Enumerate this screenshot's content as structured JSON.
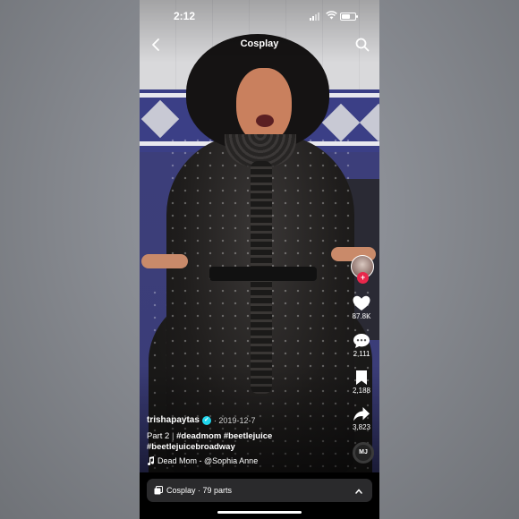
{
  "status_bar": {
    "time": "2:12"
  },
  "header": {
    "title": "Cosplay",
    "back_icon": "chevron-left-icon",
    "search_icon": "search-icon"
  },
  "actions": {
    "likes": "87.8K",
    "comments": "2,111",
    "saves": "2,188",
    "shares": "3,823",
    "follow_symbol": "+"
  },
  "caption": {
    "author": "trishapaytas",
    "date": "· 2019-12-7",
    "verified_mark": "✓",
    "part": "Part 2",
    "separator": "|",
    "hashtags_line1": "#deadmom #beetlejuice",
    "hashtags_line2": "#beetlejuicebroadway",
    "music": "Dead Mom - @Sophia Anne"
  },
  "music_disc_label": "MJ",
  "playlist": {
    "label": "Cosplay · 79 parts"
  },
  "colors": {
    "follow": "#e8274b",
    "verified": "#20d5ec"
  }
}
